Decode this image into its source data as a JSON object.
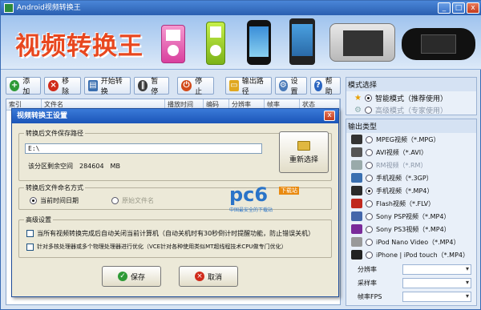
{
  "window": {
    "title": "Android视频转换王",
    "minimize": "_",
    "maximize": "□",
    "close": "x"
  },
  "banner": {
    "logo_text": "视频转换王"
  },
  "toolbar": {
    "add": "添加",
    "remove": "移除",
    "start": "开始转换",
    "pause": "暂停",
    "stop": "停止",
    "output_path": "输出路径",
    "settings": "设置",
    "help": "帮助"
  },
  "file_list": {
    "columns": [
      "索引",
      "文件名",
      "播放时间",
      "编码",
      "分辨率",
      "帧率",
      "状态"
    ]
  },
  "mode": {
    "title": "模式选择",
    "smart": "智能模式（推荐使用）",
    "advanced": "高级模式（专家使用）"
  },
  "output_types": {
    "title": "输出类型",
    "items": [
      {
        "label": "MPEG视频（*.MPG）",
        "icon": "mpeg-icon",
        "color": "#333333",
        "selected": false
      },
      {
        "label": "AVI视频（*.AVI）",
        "icon": "avi-icon",
        "color": "#555555",
        "selected": false
      },
      {
        "label": "RM视频（*.RM）",
        "icon": "rm-icon",
        "color": "#9aa",
        "selected": false,
        "disabled": true
      },
      {
        "label": "手机视频（*.3GP）",
        "icon": "3gp-icon",
        "color": "#3a6fb0",
        "selected": false
      },
      {
        "label": "手机视频（*.MP4）",
        "icon": "mp4-icon",
        "color": "#2a2a2a",
        "selected": true
      },
      {
        "label": "Flash视频（*.FLV）",
        "icon": "flash-icon",
        "color": "#c0281e",
        "selected": false
      },
      {
        "label": "Sony PSP视频（*.MP4）",
        "icon": "psp-icon",
        "color": "#4466aa",
        "selected": false
      },
      {
        "label": "Sony PS3视频（*.MP4）",
        "icon": "ps3-icon",
        "color": "#7a2a9a",
        "selected": false
      },
      {
        "label": "iPod Nano Video（*.MP4）",
        "icon": "ipod-icon",
        "color": "#999999",
        "selected": false
      },
      {
        "label": "iPhone | iPod touch（*.MP4）",
        "icon": "iphone-icon",
        "color": "#222222",
        "selected": false
      }
    ]
  },
  "params": {
    "resolution": "分辨率",
    "samplerate": "采样率",
    "fps": "帧率FPS"
  },
  "dialog": {
    "title": "视频转换王设置",
    "close": "x",
    "path_group": "转换后文件保存路径",
    "path_value": "E:\\",
    "free_space": "该分区剩余空间　284604　MB",
    "reselect": "重新选择",
    "naming_group": "转换后文件命名方式",
    "naming_time": "当前时间日期",
    "naming_original": "原始文件名",
    "advanced_group": "高级设置",
    "opt_shutdown": "当所有视频转换完成后自动关闭当前计算机（自动关机时有30秒倒计时提醒功能，防止错误关机）",
    "opt_multicore": "针对多核处理器或多个物理处理器进行优化（VCE针对各种使用类似MT超线程技术CPU做专门优化）",
    "save": "保存",
    "cancel": "取消"
  },
  "watermark": {
    "logo": "pc6",
    "badge": "下载站",
    "tagline": "中国最安全的下载站"
  }
}
